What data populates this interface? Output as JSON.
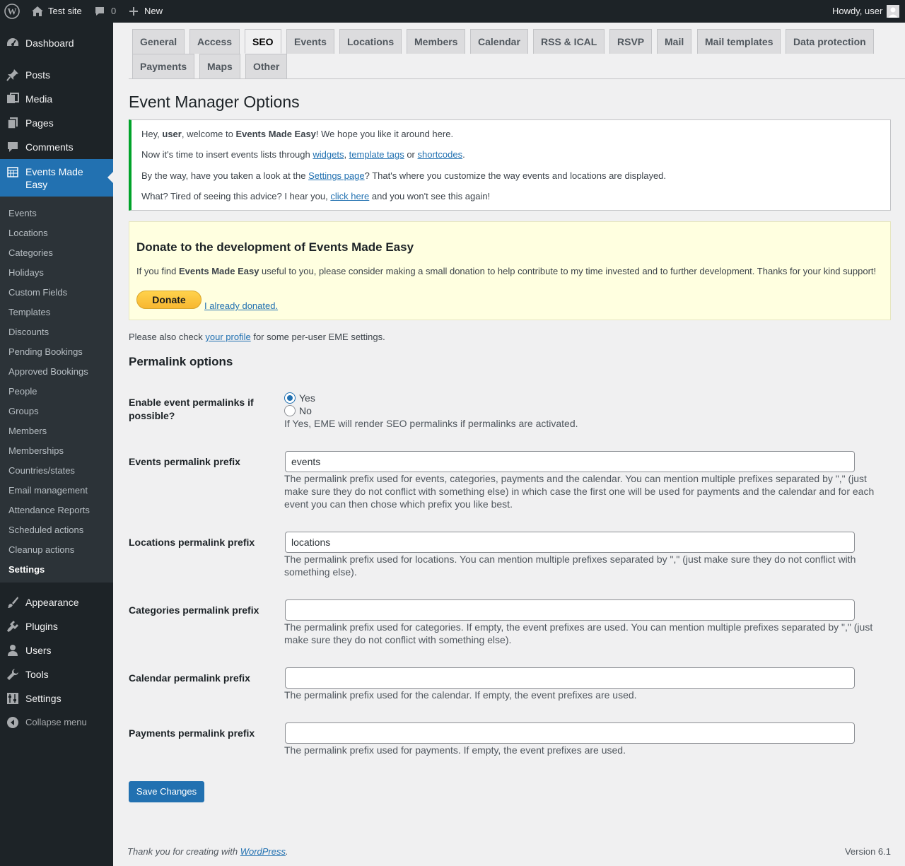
{
  "adminbar": {
    "site_name": "Test site",
    "comments_count": "0",
    "new_label": "New",
    "howdy": "Howdy, user"
  },
  "sidebar": {
    "top_items": [
      {
        "label": "Dashboard",
        "icon": "dashboard-icon"
      },
      {
        "label": "Posts",
        "icon": "pushpin-icon"
      },
      {
        "label": "Media",
        "icon": "media-icon"
      },
      {
        "label": "Pages",
        "icon": "pages-icon"
      },
      {
        "label": "Comments",
        "icon": "comment-icon"
      },
      {
        "label": "Events Made Easy",
        "icon": "calendar-icon"
      }
    ],
    "submenu": [
      "Events",
      "Locations",
      "Categories",
      "Holidays",
      "Custom Fields",
      "Templates",
      "Discounts",
      "Pending Bookings",
      "Approved Bookings",
      "People",
      "Groups",
      "Members",
      "Memberships",
      "Countries/states",
      "Email management",
      "Attendance Reports",
      "Scheduled actions",
      "Cleanup actions",
      "Settings"
    ],
    "bottom_items": [
      {
        "label": "Appearance",
        "icon": "paintbrush-icon"
      },
      {
        "label": "Plugins",
        "icon": "plugin-icon"
      },
      {
        "label": "Users",
        "icon": "user-icon"
      },
      {
        "label": "Tools",
        "icon": "wrench-icon"
      },
      {
        "label": "Settings",
        "icon": "settings-icon"
      }
    ],
    "collapse": "Collapse menu"
  },
  "tabs": [
    "General",
    "Access",
    "SEO",
    "Events",
    "Locations",
    "Members",
    "Calendar",
    "RSS & ICAL",
    "RSVP",
    "Mail",
    "Mail templates",
    "Data protection",
    "Payments",
    "Maps",
    "Other"
  ],
  "active_tab": "SEO",
  "page_title": "Event Manager Options",
  "notice": {
    "line1_a": "Hey, ",
    "line1_user": "user",
    "line1_b": ", welcome to ",
    "line1_plugin": "Events Made Easy",
    "line1_c": "! We hope you like it around here.",
    "line2_a": "Now it's time to insert events lists through ",
    "line2_link1": "widgets",
    "line2_b": ", ",
    "line2_link2": "template tags",
    "line2_c": " or ",
    "line2_link3": "shortcodes",
    "line2_d": ".",
    "line3_a": "By the way, have you taken a look at the ",
    "line3_link": "Settings page",
    "line3_b": "? That's where you customize the way events and locations are displayed.",
    "line4_a": "What? Tired of seeing this advice? I hear you, ",
    "line4_link": "click here",
    "line4_b": " and you won't see this again!"
  },
  "donate": {
    "title": "Donate to the development of Events Made Easy",
    "text_a": "If you find ",
    "text_plugin": "Events Made Easy",
    "text_b": " useful to you, please consider making a small donation to help contribute to my time invested and to further development. Thanks for your kind support!",
    "button": "Donate",
    "already": "I already donated."
  },
  "profile_note": {
    "a": "Please also check ",
    "link": "your profile",
    "b": " for some per-user EME settings."
  },
  "section_title": "Permalink options",
  "enable_permalinks": {
    "label": "Enable event permalinks if possible?",
    "yes": "Yes",
    "no": "No",
    "selected": "Yes",
    "desc": "If Yes, EME will render SEO permalinks if permalinks are activated."
  },
  "fields": {
    "events": {
      "label": "Events permalink prefix",
      "value": "events",
      "desc": "The permalink prefix used for events, categories, payments and the calendar. You can mention multiple prefixes separated by \",\" (just make sure they do not conflict with something else) in which case the first one will be used for payments and the calendar and for each event you can then chose which prefix you like best."
    },
    "locations": {
      "label": "Locations permalink prefix",
      "value": "locations",
      "desc": "The permalink prefix used for locations. You can mention multiple prefixes separated by \",\" (just make sure they do not conflict with something else)."
    },
    "categories": {
      "label": "Categories permalink prefix",
      "value": "",
      "desc": "The permalink prefix used for categories. If empty, the event prefixes are used. You can mention multiple prefixes separated by \",\" (just make sure they do not conflict with something else)."
    },
    "calendar": {
      "label": "Calendar permalink prefix",
      "value": "",
      "desc": "The permalink prefix used for the calendar. If empty, the event prefixes are used."
    },
    "payments": {
      "label": "Payments permalink prefix",
      "value": "",
      "desc": "The permalink prefix used for payments. If empty, the event prefixes are used."
    }
  },
  "save_button": "Save Changes",
  "footer": {
    "thanks_a": "Thank you for creating with ",
    "thanks_link": "WordPress",
    "thanks_b": ".",
    "version": "Version 6.1"
  },
  "colors": {
    "accent": "#2271b1",
    "sidebar": "#1d2327",
    "notice_border": "#00a32a"
  }
}
